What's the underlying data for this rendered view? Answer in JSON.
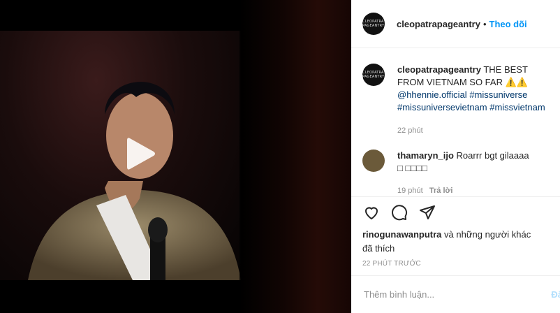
{
  "post": {
    "username": "cleopatrapageantry",
    "follow_label": "Theo dõi",
    "avatar_text": "CLEOPATRA PAGEANTRY",
    "caption_text": "THE BEST FROM VIETNAM SO FAR",
    "caption_emoji": "⚠️⚠️",
    "hashtags": [
      "@hhennie.official",
      "#missuniverse",
      "#missuniversevietnam",
      "#missvietnam"
    ],
    "caption_time": "22 phút"
  },
  "comment": {
    "username": "thamaryn_ijo",
    "text": "Roarrr bgt gilaaaa",
    "emoji": "□ □□□□",
    "time": "19 phút",
    "reply_label": "Trả lời"
  },
  "likes": {
    "user": "rinogunawanputra",
    "rest": "và những người khác",
    "liked": "đã thích"
  },
  "posted_ago": "22 PHÚT TRƯỚC",
  "add_comment": {
    "placeholder": "Thêm bình luận...",
    "post_label": "Đă"
  }
}
